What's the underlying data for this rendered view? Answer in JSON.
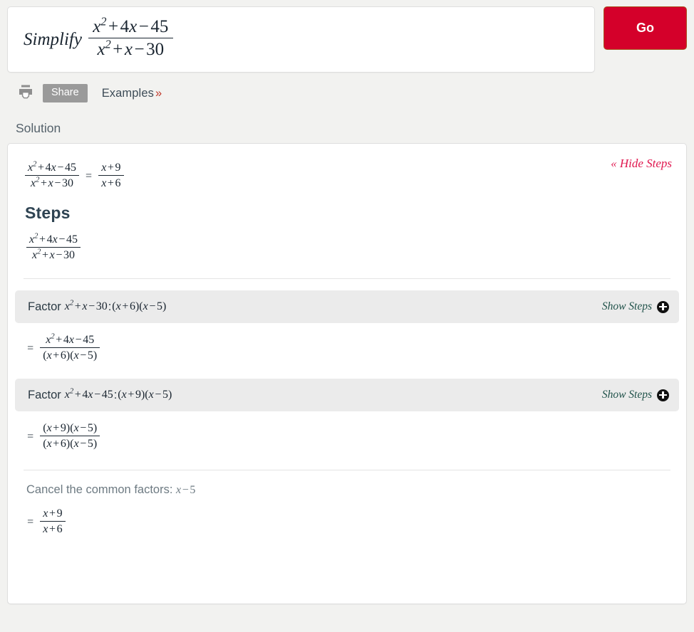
{
  "query": {
    "verb": "Simplify",
    "expression_numerator": "x^2 + 4x - 45",
    "expression_denominator": "x^2 + x - 30",
    "go_label": "Go"
  },
  "toolbar": {
    "print_icon": "printer-icon",
    "share_label": "Share",
    "examples_label": "Examples",
    "examples_chevron": "»"
  },
  "solution": {
    "label": "Solution",
    "hide_steps_label": "« Hide Steps",
    "steps_heading": "Steps",
    "result": {
      "lhs_numerator": "x^2 + 4x - 45",
      "lhs_denominator": "x^2 + x - 30",
      "equals": "=",
      "rhs_numerator": "x + 9",
      "rhs_denominator": "x + 6"
    },
    "step1": {
      "numerator": "x^2 + 4x - 45",
      "denominator": "x^2 + x - 30"
    },
    "factor_bars": [
      {
        "prefix": "Factor",
        "target": "x^2 + x - 30",
        "colon": ":",
        "result": "(x + 6)(x - 5)",
        "show_steps_label": "Show Steps",
        "plus_icon": "plus-circle-icon"
      },
      {
        "prefix": "Factor",
        "target": "x^2 + 4x - 45",
        "colon": ":",
        "result": "(x + 9)(x - 5)",
        "show_steps_label": "Show Steps",
        "plus_icon": "plus-circle-icon"
      }
    ],
    "step_after_first_factor": {
      "equals": "=",
      "numerator": "x^2 + 4x - 45",
      "denominator": "(x + 6)(x - 5)"
    },
    "step_after_second_factor": {
      "equals": "=",
      "numerator": "(x + 9)(x - 5)",
      "denominator": "(x + 6)(x - 5)"
    },
    "cancel": {
      "text": "Cancel the common factors:",
      "factor": "x - 5"
    },
    "final": {
      "equals": "=",
      "numerator": "x + 9",
      "denominator": "x + 6"
    }
  },
  "colors": {
    "go_button": "#d4002a",
    "hide_steps": "#e0174f",
    "show_steps": "#1f5149",
    "share_button": "#9a9a9a",
    "factor_bar": "#ebebeb",
    "page_bg": "#f2f2f0"
  }
}
